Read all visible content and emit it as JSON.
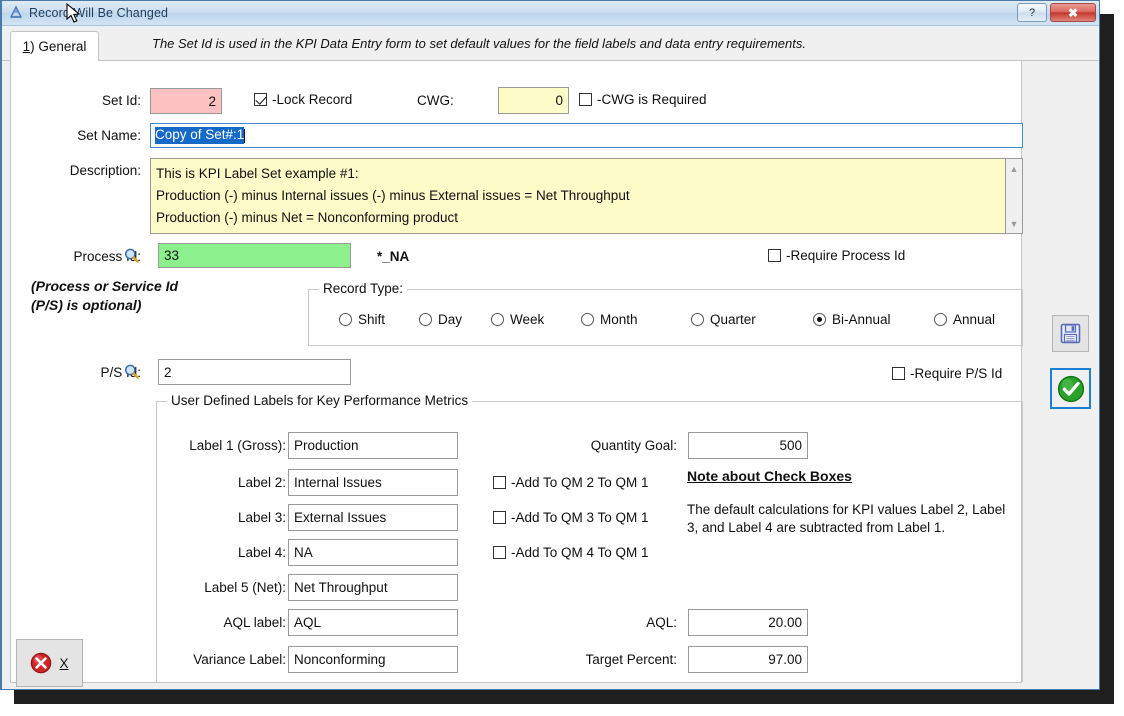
{
  "window": {
    "title": "Record Will Be Changed",
    "app_icon": "mountain-icon",
    "help_label": "?",
    "close_label": "✖"
  },
  "tabs": [
    {
      "label_prefix": "1",
      "label_suffix": ") General",
      "name": "tab-general"
    }
  ],
  "header_hint": "The Set Id is used in the KPI Data Entry form to set default values for the field labels and data entry requirements.",
  "fields": {
    "set_id_label": "Set Id:",
    "set_id_value": "2",
    "lock_record_label": "-Lock Record",
    "lock_record_checked": true,
    "cwg_label": "CWG:",
    "cwg_value": "0",
    "cwg_required_label": "-CWG is Required",
    "cwg_required_checked": false,
    "set_name_label": "Set Name:",
    "set_name_value": "Copy of Set#:1",
    "description_label": "Description:",
    "description_value": "This is KPI Label Set example #1:\nProduction (-) minus Internal issues (-) minus External issues = Net Throughput\nProduction (-) minus Net = Nonconforming product",
    "process_id_label": "Process Id:",
    "process_id_value": "33",
    "process_id_suffix": "*_NA",
    "require_process_id_label": "-Require Process Id",
    "require_process_id_checked": false,
    "process_note": "(Process or Service Id\n(P/S) is optional)",
    "ps_id_label": "P/S Id:",
    "ps_id_value": "2",
    "require_ps_id_label": "-Require P/S Id",
    "require_ps_id_checked": false
  },
  "record_type": {
    "group_title": "Record Type:",
    "selected": "Bi-Annual",
    "options": [
      {
        "label": "Shift",
        "selected": false
      },
      {
        "label": "Day",
        "selected": false
      },
      {
        "label": "Week",
        "selected": false
      },
      {
        "label": "Month",
        "selected": false
      },
      {
        "label": "Quarter",
        "selected": false
      },
      {
        "label": "Bi-Annual",
        "selected": true
      },
      {
        "label": "Annual",
        "selected": false
      }
    ]
  },
  "labels_group": {
    "group_title": "User Defined Labels for Key Performance Metrics",
    "rows": [
      {
        "label": "Label 1 (Gross):",
        "value": "Production"
      },
      {
        "label": "Label 2:",
        "value": "Internal Issues"
      },
      {
        "label": "Label 3:",
        "value": "External Issues"
      },
      {
        "label": "Label 4:",
        "value": "NA"
      },
      {
        "label": "Label 5 (Net):",
        "value": "Net Throughput"
      },
      {
        "label": "AQL label:",
        "value": "AQL"
      },
      {
        "label": "Variance Label:",
        "value": "Nonconforming"
      }
    ],
    "quantity_goal_label": "Quantity Goal:",
    "quantity_goal_value": "500",
    "add_checkboxes": [
      {
        "label": "-Add To QM 2 To QM 1",
        "checked": false
      },
      {
        "label": "-Add To QM 3 To QM 1",
        "checked": false
      },
      {
        "label": "-Add To QM 4 To QM 1",
        "checked": false
      }
    ],
    "note_heading": "Note about Check Boxes",
    "note_body": "The default calculations for KPI values Label 2, Label 3, and Label 4 are subtracted from Label 1.",
    "aql_label": "AQL:",
    "aql_value": "20.00",
    "target_percent_label": "Target Percent:",
    "target_percent_value": "97.00"
  },
  "rail": {
    "save_icon": "floppy-disk-icon",
    "ok_icon": "green-check-icon"
  },
  "close_button": {
    "icon": "red-x-circle-icon",
    "label": "X"
  },
  "colors": {
    "titlebar": "#cbdcef",
    "accent_blue": "#1b7fd4",
    "set_id_bg": "#fcc1c0",
    "cwg_bg": "#fdfbc8",
    "process_id_bg": "#8cf08c",
    "description_bg": "#fdfbc8",
    "selection_blue": "#1569c7"
  }
}
